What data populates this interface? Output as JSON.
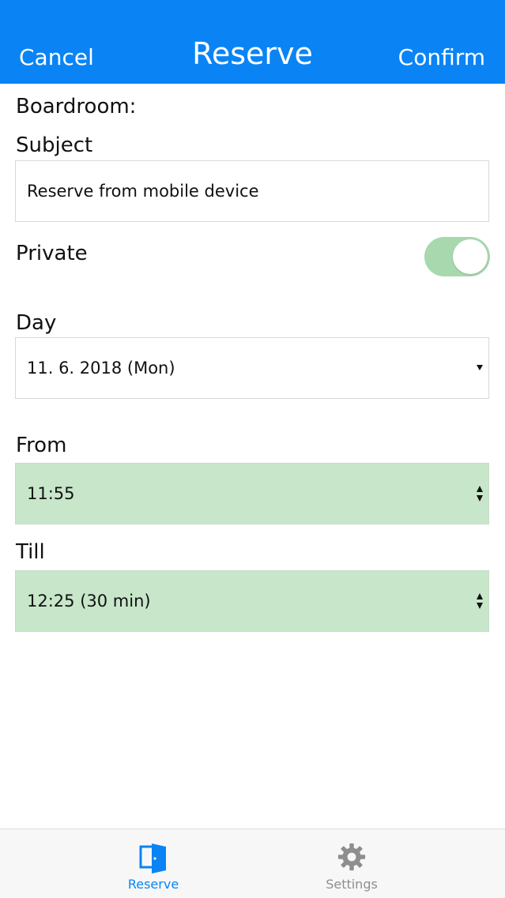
{
  "navbar": {
    "cancel_label": "Cancel",
    "title": "Reserve",
    "confirm_label": "Confirm",
    "background_color": "#0a84f5"
  },
  "form": {
    "room_label": "Boardroom:",
    "subject_label": "Subject",
    "subject_value": "Reserve from mobile device",
    "private_label": "Private",
    "private_enabled": true,
    "day_label": "Day",
    "day_value": "11. 6. 2018 (Mon)",
    "from_label": "From",
    "from_value": "11:55",
    "till_label": "Till",
    "till_value": "12:25 (30 min)",
    "highlight_color": "#c8e6c9"
  },
  "tabbar": {
    "items": [
      {
        "label": "Reserve",
        "icon": "door-icon",
        "active": true
      },
      {
        "label": "Settings",
        "icon": "gear-icon",
        "active": false
      }
    ]
  }
}
